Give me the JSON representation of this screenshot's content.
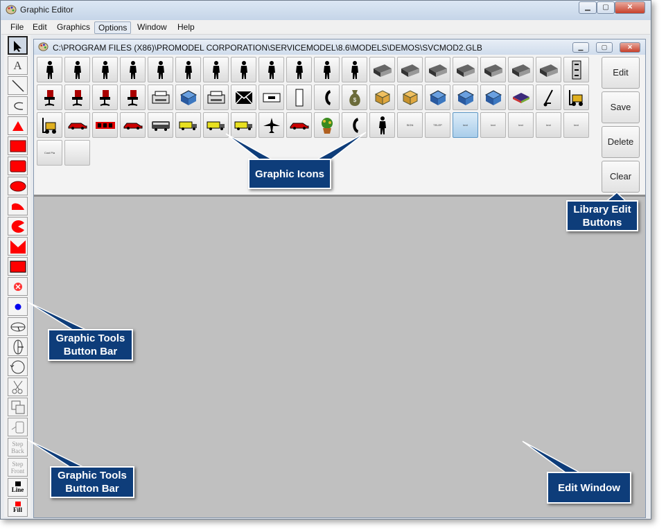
{
  "window": {
    "title": "Graphic Editor"
  },
  "menu": [
    "File",
    "Edit",
    "Graphics",
    "Options",
    "Window",
    "Help"
  ],
  "library": {
    "path": "C:\\PROGRAM FILES (X86)\\PROMODEL CORPORATION\\SERVICEMODEL\\8.6\\MODELS\\DEMOS\\SVCMOD2.GLB",
    "icons": [
      {
        "name": "person-icon"
      },
      {
        "name": "person-icon"
      },
      {
        "name": "person-icon"
      },
      {
        "name": "person-icon"
      },
      {
        "name": "person-icon"
      },
      {
        "name": "person-icon"
      },
      {
        "name": "person-icon"
      },
      {
        "name": "person-icon"
      },
      {
        "name": "person-icon"
      },
      {
        "name": "person-icon"
      },
      {
        "name": "person-icon"
      },
      {
        "name": "person-icon"
      },
      {
        "name": "desk-icon"
      },
      {
        "name": "desk-icon"
      },
      {
        "name": "desk-icon"
      },
      {
        "name": "desk-icon"
      },
      {
        "name": "desk-icon"
      },
      {
        "name": "desk-icon"
      },
      {
        "name": "desk-icon"
      },
      {
        "name": "cabinet-icon"
      },
      {
        "name": "chair-icon"
      },
      {
        "name": "chair-icon"
      },
      {
        "name": "chair-icon"
      },
      {
        "name": "chair-icon"
      },
      {
        "name": "printer-icon"
      },
      {
        "name": "machine-icon"
      },
      {
        "name": "printer-icon"
      },
      {
        "name": "envelope-icon"
      },
      {
        "name": "sign-icon"
      },
      {
        "name": "door-icon"
      },
      {
        "name": "phone-icon"
      },
      {
        "name": "money-bag-icon"
      },
      {
        "name": "box-icon"
      },
      {
        "name": "box-icon"
      },
      {
        "name": "machine-icon"
      },
      {
        "name": "machine-icon"
      },
      {
        "name": "machine-icon"
      },
      {
        "name": "bar-icon"
      },
      {
        "name": "hand-truck-icon"
      },
      {
        "name": "forklift-icon"
      },
      {
        "name": "forklift-icon"
      },
      {
        "name": "car-icon"
      },
      {
        "name": "train-icon"
      },
      {
        "name": "car-icon"
      },
      {
        "name": "bus-icon"
      },
      {
        "name": "truck-icon"
      },
      {
        "name": "truck-icon"
      },
      {
        "name": "truck-icon"
      },
      {
        "name": "airplane-icon"
      },
      {
        "name": "car-icon"
      },
      {
        "name": "plant-icon"
      },
      {
        "name": "phone-icon"
      },
      {
        "name": "person-icon"
      },
      {
        "name": "label-icon",
        "text": "SIGN"
      },
      {
        "name": "label-icon",
        "text": "TELEP"
      },
      {
        "name": "label-icon",
        "text": "text"
      },
      {
        "name": "label-icon",
        "text": "text"
      },
      {
        "name": "label-icon",
        "text": "text"
      },
      {
        "name": "label-icon",
        "text": "text"
      },
      {
        "name": "label-icon",
        "text": "text"
      },
      {
        "name": "label-icon",
        "text": "Cust Pla"
      },
      {
        "name": "blank-icon"
      }
    ],
    "selected_index": 55
  },
  "library_buttons": {
    "edit": "Edit",
    "save": "Save",
    "delete": "Delete",
    "clear": "Clear"
  },
  "toolbar": {
    "step_back": "Step Back",
    "step_front": "Step Front",
    "line": "Line",
    "fill": "Fill"
  },
  "callouts": {
    "graphic_icons": "Graphic Icons",
    "library_edit": "Library Edit Buttons",
    "tools_bar_1": "Graphic Tools Button Bar",
    "tools_bar_2": "Graphic Tools Button Bar",
    "edit_window": "Edit Window"
  },
  "colors": {
    "shape_red": "#ff0000",
    "callout_blue": "#0e3d7a",
    "canvas_gray": "#c0c0c0"
  }
}
